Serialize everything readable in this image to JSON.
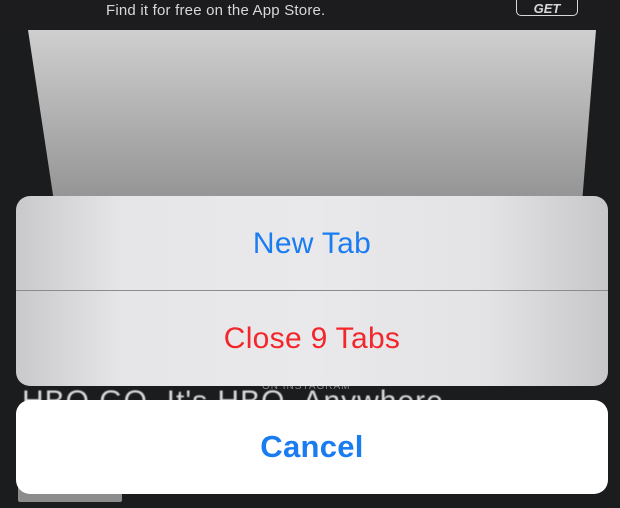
{
  "banner": {
    "subtitle": "Find it for free on the App Store.",
    "get_label": "GET"
  },
  "background": {
    "headline": "HBO GO, It's HBO. Anywhere.",
    "small_caption": "ON INSTAGRAM"
  },
  "action_sheet": {
    "new_tab_label": "New Tab",
    "close_tabs_label": "Close 9 Tabs",
    "cancel_label": "Cancel"
  },
  "colors": {
    "action_blue": "#1a7cf1",
    "destructive_red": "#f2262b"
  }
}
